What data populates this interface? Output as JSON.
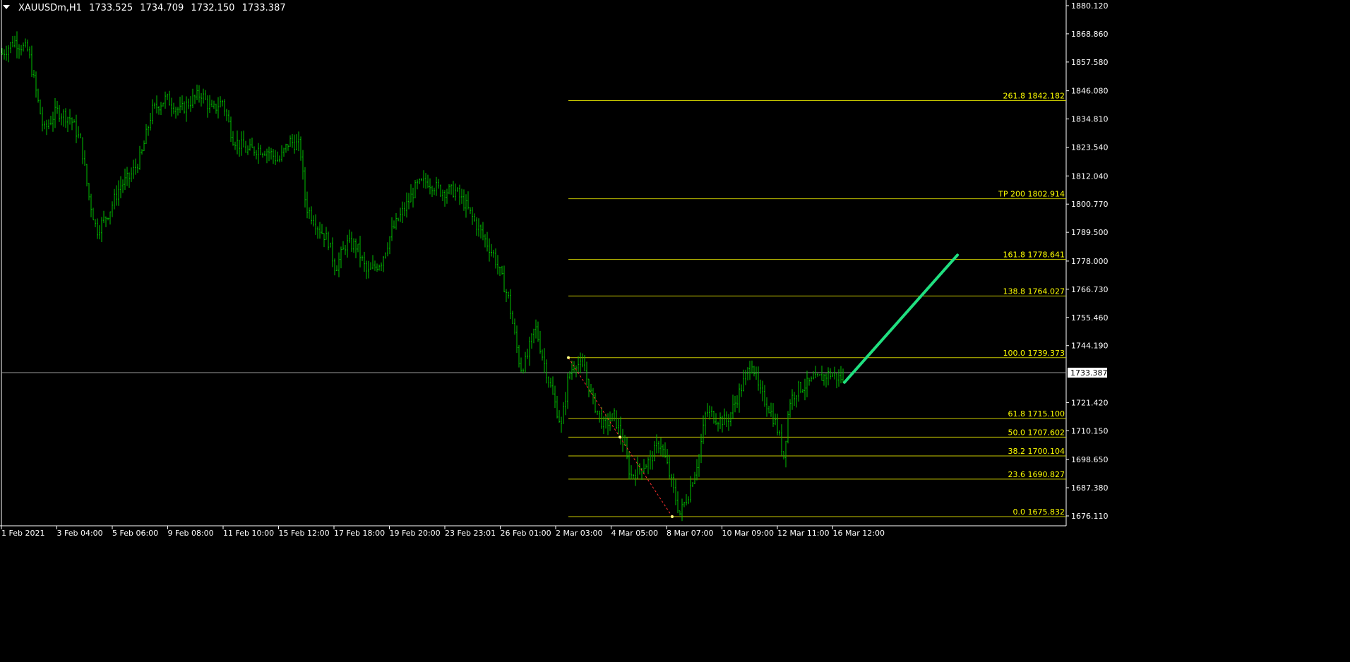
{
  "header": {
    "symbol": "XAUUSDm,H1",
    "open": "1733.525",
    "high": "1734.709",
    "low": "1732.150",
    "close": "1733.387"
  },
  "colors": {
    "background": "#000000",
    "candles": "#00c000",
    "fib_levels": "#c8c800",
    "fib_text": "#ffff00",
    "projection": "#20e080",
    "fib_baseline": "#ff3030",
    "axis_text": "#ffffff",
    "current_price_line": "#9a9a9a"
  },
  "chart_data": {
    "type": "candlestick",
    "ylim": [
      1670.0,
      1882.0
    ],
    "yticks": [
      "1880.120",
      "1868.860",
      "1857.580",
      "1846.080",
      "1834.810",
      "1823.540",
      "1812.040",
      "1800.770",
      "1789.500",
      "1778.000",
      "1766.730",
      "1755.460",
      "1744.190",
      "1733.387",
      "1721.420",
      "1710.150",
      "1698.650",
      "1687.380",
      "1676.110"
    ],
    "xticks": [
      "1 Feb 2021",
      "3 Feb 04:00",
      "5 Feb 06:00",
      "9 Feb 08:00",
      "11 Feb 10:00",
      "15 Feb 12:00",
      "17 Feb 18:00",
      "19 Feb 20:00",
      "23 Feb 23:01",
      "26 Feb 01:00",
      "2 Mar 03:00",
      "4 Mar 05:00",
      "8 Mar 07:00",
      "10 Mar 09:00",
      "12 Mar 11:00",
      "16 Mar 12:00"
    ],
    "current_price": 1733.387,
    "path": [
      [
        0,
        1860
      ],
      [
        20,
        1866
      ],
      [
        40,
        1862
      ],
      [
        55,
        1840
      ],
      [
        62,
        1830
      ],
      [
        80,
        1838
      ],
      [
        100,
        1835
      ],
      [
        115,
        1825
      ],
      [
        125,
        1805
      ],
      [
        137,
        1790
      ],
      [
        155,
        1798
      ],
      [
        170,
        1808
      ],
      [
        185,
        1812
      ],
      [
        200,
        1820
      ],
      [
        215,
        1838
      ],
      [
        235,
        1843
      ],
      [
        255,
        1838
      ],
      [
        270,
        1842
      ],
      [
        285,
        1845
      ],
      [
        300,
        1838
      ],
      [
        315,
        1842
      ],
      [
        330,
        1827
      ],
      [
        350,
        1822
      ],
      [
        365,
        1823
      ],
      [
        380,
        1822
      ],
      [
        395,
        1818
      ],
      [
        410,
        1826
      ],
      [
        425,
        1824
      ],
      [
        433,
        1800
      ],
      [
        450,
        1792
      ],
      [
        465,
        1786
      ],
      [
        475,
        1775
      ],
      [
        490,
        1785
      ],
      [
        505,
        1784
      ],
      [
        520,
        1773
      ],
      [
        540,
        1778
      ],
      [
        555,
        1790
      ],
      [
        575,
        1800
      ],
      [
        590,
        1808
      ],
      [
        605,
        1810
      ],
      [
        625,
        1806
      ],
      [
        645,
        1806
      ],
      [
        660,
        1800
      ],
      [
        680,
        1790
      ],
      [
        700,
        1780
      ],
      [
        720,
        1763
      ],
      [
        737,
        1735
      ],
      [
        745,
        1738
      ],
      [
        758,
        1752
      ],
      [
        770,
        1738
      ],
      [
        785,
        1722
      ],
      [
        795,
        1712
      ],
      [
        805,
        1732
      ],
      [
        815,
        1738
      ],
      [
        828,
        1734
      ],
      [
        840,
        1722
      ],
      [
        855,
        1712
      ],
      [
        870,
        1716
      ],
      [
        883,
        1705
      ],
      [
        893,
        1692
      ],
      [
        905,
        1695
      ],
      [
        920,
        1698
      ],
      [
        935,
        1706
      ],
      [
        945,
        1696
      ],
      [
        955,
        1685
      ],
      [
        963,
        1677
      ],
      [
        975,
        1685
      ],
      [
        990,
        1700
      ],
      [
        1000,
        1718
      ],
      [
        1015,
        1715
      ],
      [
        1030,
        1714
      ],
      [
        1045,
        1724
      ],
      [
        1058,
        1733
      ],
      [
        1065,
        1738
      ],
      [
        1075,
        1726
      ],
      [
        1088,
        1720
      ],
      [
        1100,
        1712
      ],
      [
        1110,
        1700
      ],
      [
        1118,
        1722
      ],
      [
        1130,
        1727
      ],
      [
        1145,
        1729
      ],
      [
        1160,
        1731
      ],
      [
        1175,
        1733
      ],
      [
        1190,
        1731
      ],
      [
        1196,
        1733
      ]
    ],
    "fib_levels": [
      {
        "label": "261.8 1842.182",
        "value": 1842.182
      },
      {
        "label": "TP 200 1802.914",
        "value": 1802.914
      },
      {
        "label": "161.8 1778.641",
        "value": 1778.641
      },
      {
        "label": "138.8 1764.027",
        "value": 1764.027
      },
      {
        "label": "100.0 1739.373",
        "value": 1739.373
      },
      {
        "label": "61.8 1715.100",
        "value": 1715.1
      },
      {
        "label": "50.0 1707.602",
        "value": 1707.602
      },
      {
        "label": "38.2 1700.104",
        "value": 1700.104
      },
      {
        "label": "23.6 1690.827",
        "value": 1690.827
      },
      {
        "label": "0.0 1675.832",
        "value": 1675.832
      }
    ],
    "projection": {
      "from": [
        1196,
        1729.5
      ],
      "to": [
        1356,
        1780.4
      ]
    }
  }
}
